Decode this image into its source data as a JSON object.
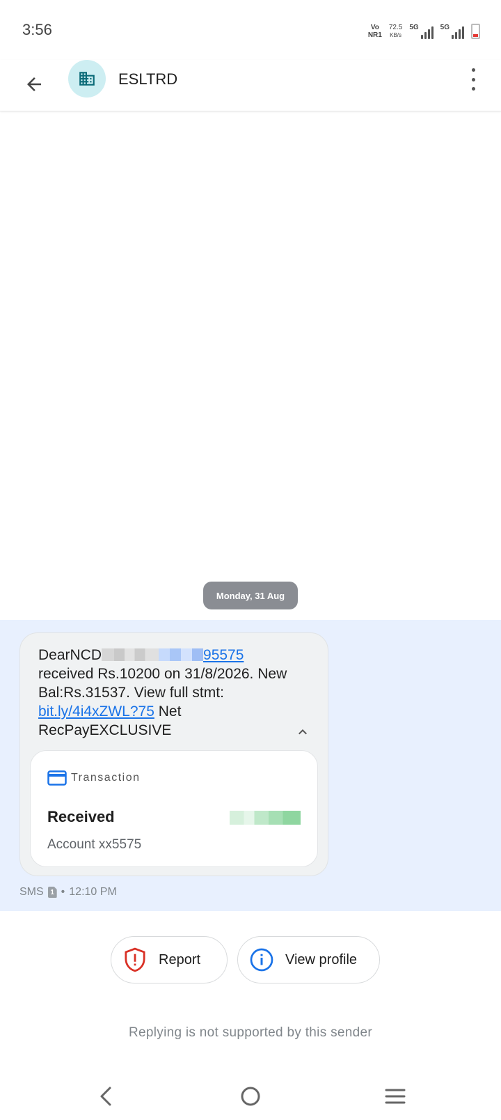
{
  "status_bar": {
    "time": "3:56",
    "volte_top": "Vo",
    "volte_bottom": "NR1",
    "speed_value": "72.5",
    "speed_unit": "KB/s",
    "sim1_label": "5G",
    "sim2_label": "5G"
  },
  "app_bar": {
    "sender_name": "ESLTRD",
    "back_icon": "arrow-left-icon",
    "avatar_icon": "business-building-icon",
    "more_icon": "more-vertical-icon"
  },
  "conversation": {
    "date_chip": "Monday, 31 Aug",
    "message": {
      "prefix": "DearNCD",
      "link_suffix": "95575",
      "line2": " received Rs.10200 on 31/8/2026. New Bal:Rs.31537. View full stmt: ",
      "short_link": "bit.ly/4i4xZWL?75",
      "line3": " Net RecPayEXCLUSIVE"
    },
    "transaction_card": {
      "header_label": "Transaction",
      "status": "Received",
      "account": "Account xx5575"
    },
    "meta": {
      "channel": "SMS",
      "sim_number": "1",
      "separator": "•",
      "time": "12:10 PM"
    }
  },
  "actions": {
    "report_label": "Report",
    "view_profile_label": "View profile"
  },
  "reply_note": "Replying is not supported by this sender",
  "colors": {
    "highlight_bg": "#e8f0fe",
    "link": "#1a73e8",
    "report_red": "#d93025",
    "info_blue": "#1a73e8",
    "avatar_bg": "#cdeef2",
    "avatar_icon": "#0b6b78"
  }
}
